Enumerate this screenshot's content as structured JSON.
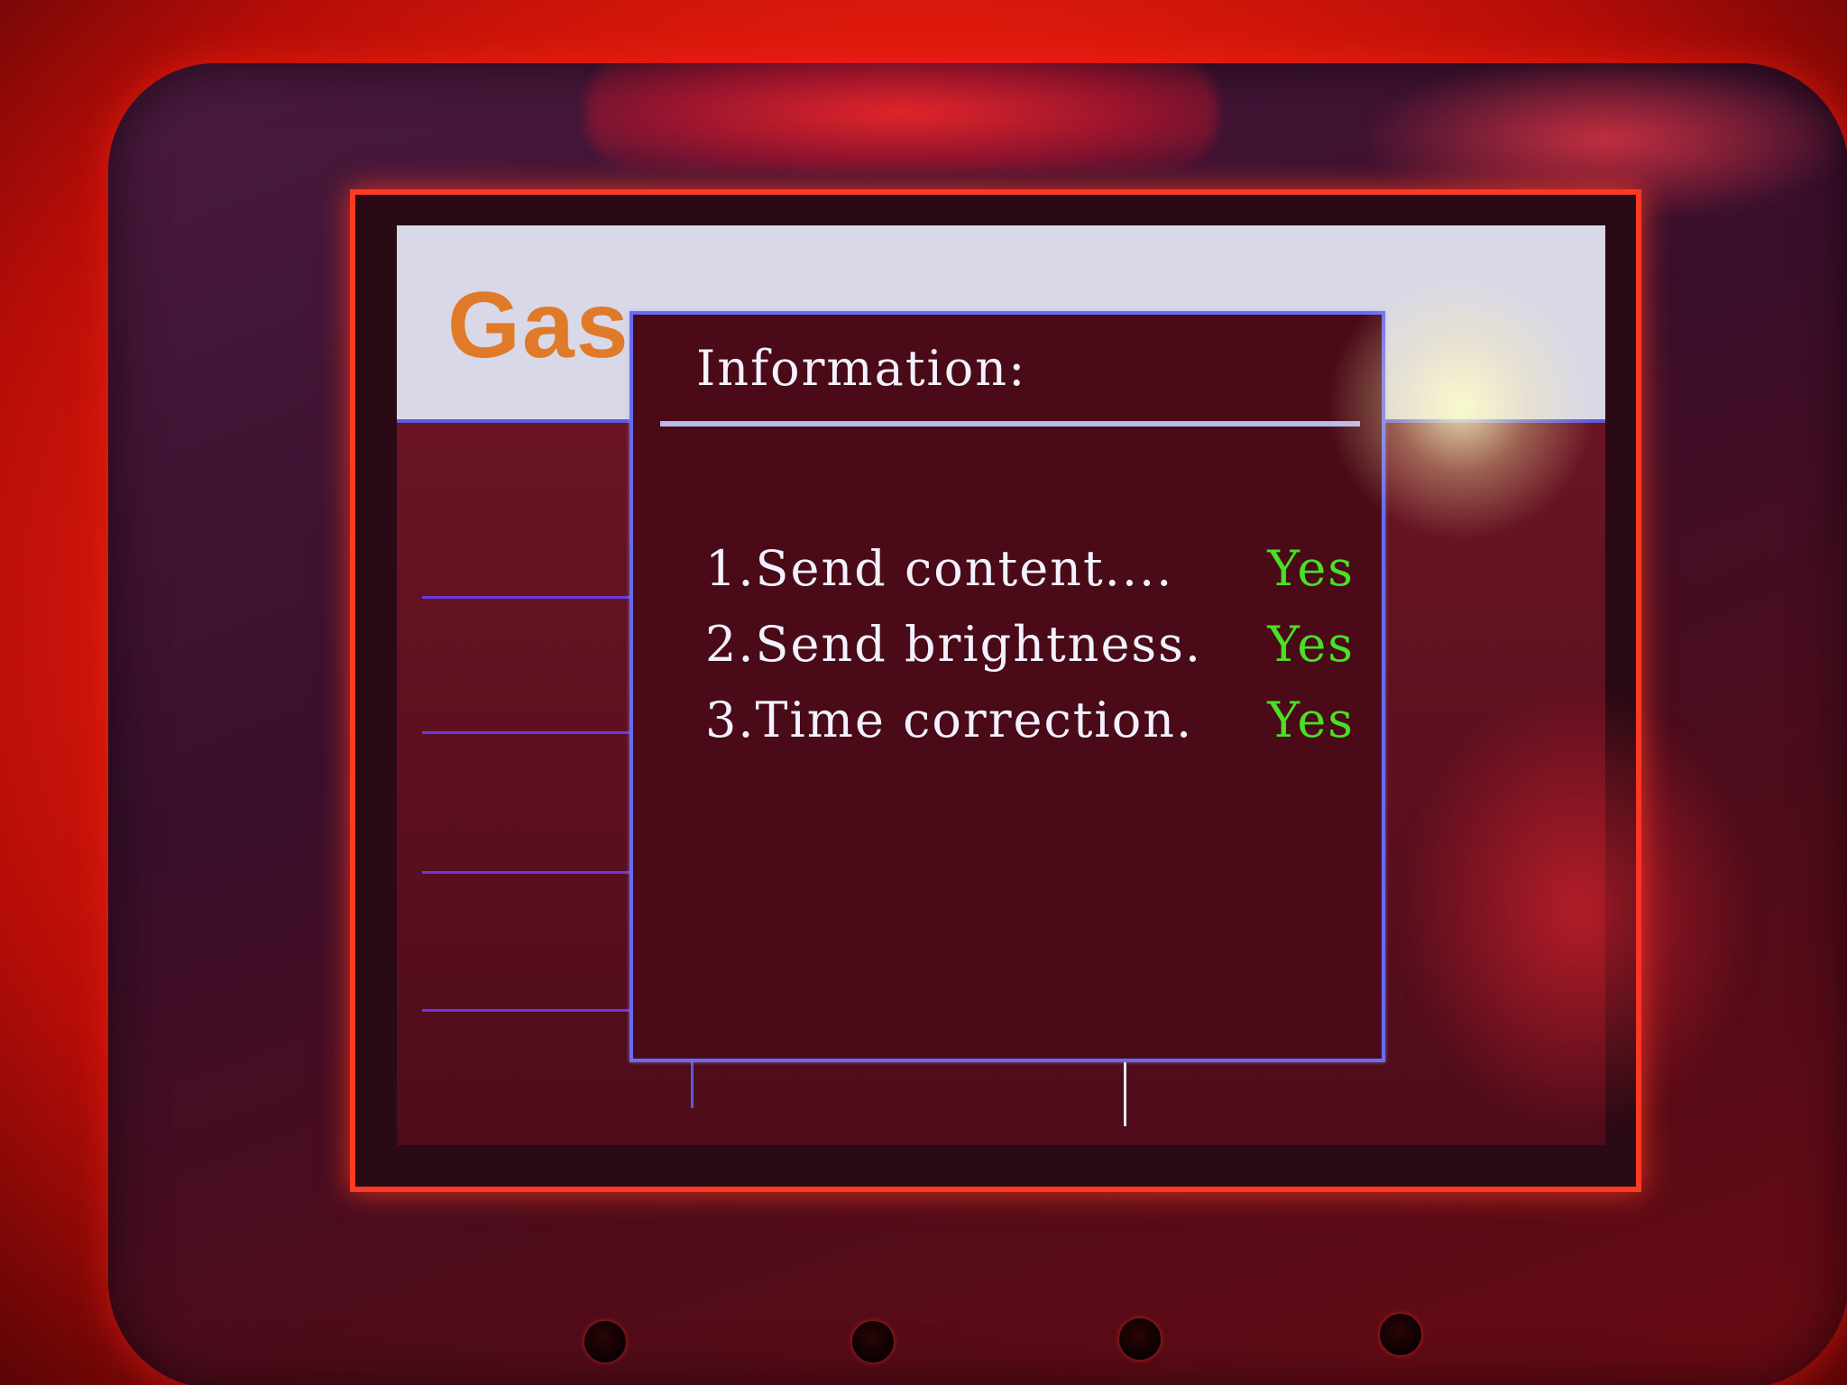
{
  "device": {
    "logo_text": "Gas"
  },
  "dialog": {
    "title": "Information:",
    "items": [
      {
        "label": "1.Send content....",
        "status": "Yes"
      },
      {
        "label": "2.Send brightness.",
        "status": "Yes"
      },
      {
        "label": "3.Time correction.",
        "status": "Yes"
      }
    ]
  },
  "colors": {
    "status_ok": "#49e025",
    "logo": "#e07a28",
    "dialog_border": "#6a6af0"
  }
}
